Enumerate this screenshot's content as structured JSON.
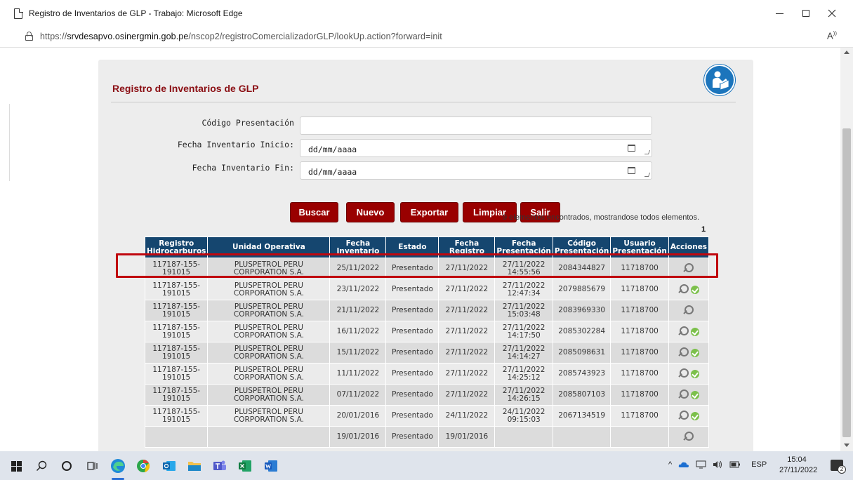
{
  "window": {
    "title": "Registro de Inventarios de GLP - Trabajo: Microsoft Edge",
    "url_prefix": "https://",
    "url_host": "srvdesapvo.osinergmin.gob.pe",
    "url_path": "/nscop2/registroComercializadorGLP/lookUp.action?forward=init",
    "read_aloud": "Ă⁾"
  },
  "page": {
    "title": "Registro de Inventarios de GLP",
    "form": {
      "codigo_label": "Código Presentación",
      "codigo_value": "",
      "fecha_inicio_label": "Fecha Inventario Inicio:",
      "fecha_inicio_value": "dd/mm/aaaa",
      "fecha_fin_label": "Fecha Inventario Fin:",
      "fecha_fin_value": "dd/mm/aaaa"
    },
    "buttons": {
      "buscar": "Buscar",
      "nuevo": "Nuevo",
      "exportar": "Exportar",
      "limpiar": "Limpiar",
      "salir": "Salir"
    },
    "results_message": "9 elementos encontrados, mostrandose todos elementos.",
    "page_number": "1"
  },
  "table": {
    "headers": {
      "registro": [
        "Registro",
        "Hidrocarburos"
      ],
      "unidad": "Unidad Operativa",
      "fecha_inv": [
        "Fecha",
        "Inventario"
      ],
      "estado": "Estado",
      "fecha_reg": [
        "Fecha",
        "Registro"
      ],
      "fecha_pres": [
        "Fecha",
        "Presentación"
      ],
      "codigo": [
        "Código",
        "Presentación"
      ],
      "usuario": [
        "Usuario",
        "Presentación"
      ],
      "acciones": "Acciones"
    },
    "rows": [
      {
        "reg1": "117187-155-",
        "reg2": "191015",
        "uni1": "PLUSPETROL PERU",
        "uni2": "CORPORATION S.A.",
        "fecha_inv": "25/11/2022",
        "estado": "Presentado",
        "fecha_reg": "27/11/2022",
        "pres1": "27/11/2022",
        "pres2": "14:55:56",
        "codigo": "2084344827",
        "usuario": "11718700"
      },
      {
        "reg1": "117187-155-",
        "reg2": "191015",
        "uni1": "PLUSPETROL PERU",
        "uni2": "CORPORATION S.A.",
        "fecha_inv": "23/11/2022",
        "estado": "Presentado",
        "fecha_reg": "27/11/2022",
        "pres1": "27/11/2022",
        "pres2": "12:47:34",
        "codigo": "2079885679",
        "usuario": "11718700"
      },
      {
        "reg1": "117187-155-",
        "reg2": "191015",
        "uni1": "PLUSPETROL PERU",
        "uni2": "CORPORATION S.A.",
        "fecha_inv": "21/11/2022",
        "estado": "Presentado",
        "fecha_reg": "27/11/2022",
        "pres1": "27/11/2022",
        "pres2": "15:03:48",
        "codigo": "2083969330",
        "usuario": "11718700"
      },
      {
        "reg1": "117187-155-",
        "reg2": "191015",
        "uni1": "PLUSPETROL PERU",
        "uni2": "CORPORATION S.A.",
        "fecha_inv": "16/11/2022",
        "estado": "Presentado",
        "fecha_reg": "27/11/2022",
        "pres1": "27/11/2022",
        "pres2": "14:17:50",
        "codigo": "2085302284",
        "usuario": "11718700"
      },
      {
        "reg1": "117187-155-",
        "reg2": "191015",
        "uni1": "PLUSPETROL PERU",
        "uni2": "CORPORATION S.A.",
        "fecha_inv": "15/11/2022",
        "estado": "Presentado",
        "fecha_reg": "27/11/2022",
        "pres1": "27/11/2022",
        "pres2": "14:14:27",
        "codigo": "2085098631",
        "usuario": "11718700"
      },
      {
        "reg1": "117187-155-",
        "reg2": "191015",
        "uni1": "PLUSPETROL PERU",
        "uni2": "CORPORATION S.A.",
        "fecha_inv": "11/11/2022",
        "estado": "Presentado",
        "fecha_reg": "27/11/2022",
        "pres1": "27/11/2022",
        "pres2": "14:25:12",
        "codigo": "2085743923",
        "usuario": "11718700"
      },
      {
        "reg1": "117187-155-",
        "reg2": "191015",
        "uni1": "PLUSPETROL PERU",
        "uni2": "CORPORATION S.A.",
        "fecha_inv": "07/11/2022",
        "estado": "Presentado",
        "fecha_reg": "27/11/2022",
        "pres1": "27/11/2022",
        "pres2": "14:26:15",
        "codigo": "2085807103",
        "usuario": "11718700"
      },
      {
        "reg1": "117187-155-",
        "reg2": "191015",
        "uni1": "PLUSPETROL PERU",
        "uni2": "CORPORATION S.A.",
        "fecha_inv": "20/01/2016",
        "estado": "Presentado",
        "fecha_reg": "24/11/2022",
        "pres1": "24/11/2022",
        "pres2": "09:15:03",
        "codigo": "2067134519",
        "usuario": "11718700"
      },
      {
        "reg1": "",
        "reg2": "",
        "uni1": "",
        "uni2": "",
        "fecha_inv": "19/01/2016",
        "estado": "Presentado",
        "fecha_reg": "19/01/2016",
        "pres1": "",
        "pres2": "",
        "codigo": "",
        "usuario": ""
      }
    ]
  },
  "taskbar": {
    "language": "ESP",
    "time": "15:04",
    "date": "27/11/2022",
    "notification_count": "2",
    "tray_chevron": "^"
  }
}
